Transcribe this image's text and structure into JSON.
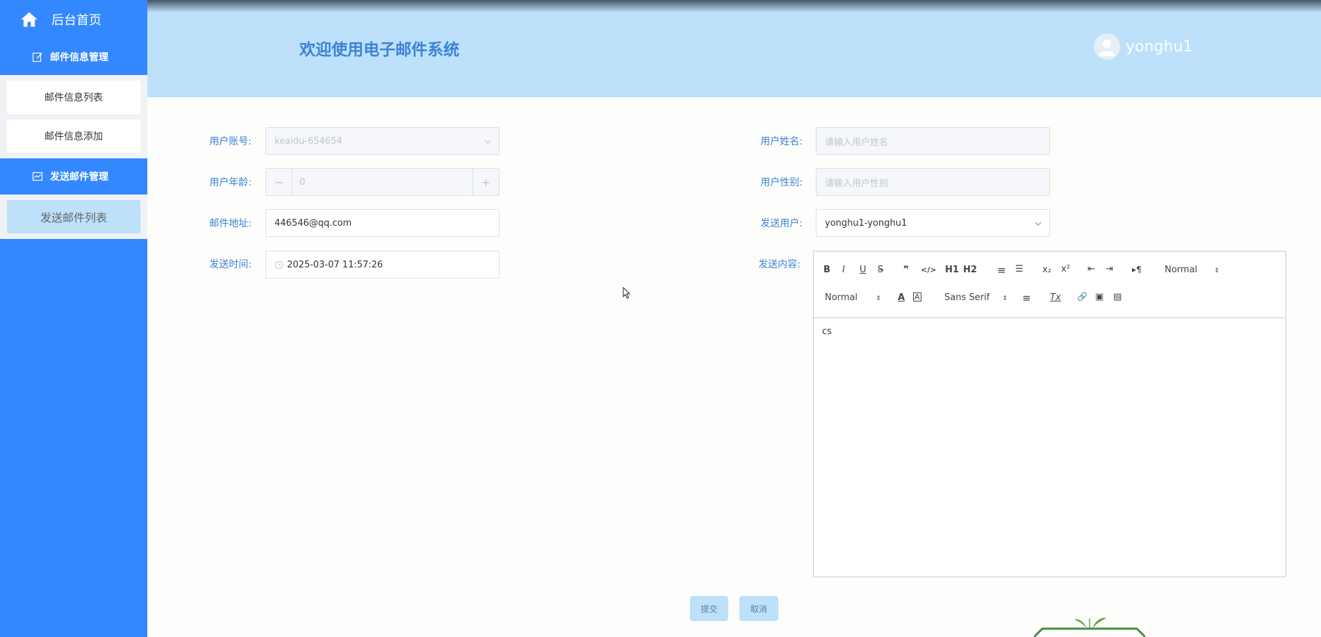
{
  "sidebar": {
    "home_label": "后台首页",
    "groups": [
      {
        "label": "邮件信息管理",
        "items": [
          {
            "label": "邮件信息列表"
          },
          {
            "label": "邮件信息添加"
          }
        ]
      },
      {
        "label": "发送邮件管理",
        "items": [
          {
            "label": "发送邮件列表"
          }
        ]
      }
    ]
  },
  "header": {
    "title": "欢迎使用电子邮件系统",
    "username": "yonghu1"
  },
  "form": {
    "account": {
      "label": "用户账号:",
      "value": "keaidu-654654"
    },
    "name": {
      "label": "用户姓名:",
      "placeholder": "请输入用户姓名"
    },
    "age": {
      "label": "用户年龄:",
      "value": "0",
      "minus": "−",
      "plus": "+"
    },
    "gender": {
      "label": "用户性别:",
      "placeholder": "请输入用户性别"
    },
    "email": {
      "label": "邮件地址:",
      "value": "446546@qq.com"
    },
    "send_user": {
      "label": "发送用户:",
      "value": "yonghu1-yonghu1"
    },
    "send_time": {
      "label": "发送时间:",
      "value": "2025-03-07 11:57:26"
    },
    "content": {
      "label": "发送内容:",
      "value": "cs"
    }
  },
  "editor": {
    "toolbar": {
      "bold": "B",
      "italic": "I",
      "underline": "U",
      "strike": "S",
      "quote": "❞",
      "code": "</>",
      "h1": "H1",
      "h2": "H2",
      "ordered": "≡",
      "bullet": "☰",
      "sub": "x₂",
      "sup": "x²",
      "outdent": "⇤",
      "indent": "⇥",
      "direction": "▸¶",
      "size": "Normal",
      "header": "Normal",
      "font": "Sans Serif",
      "color": "A",
      "background": "A",
      "align": "≡",
      "clean": "Tx",
      "link": "🔗",
      "image": "▣",
      "video": "▤"
    }
  },
  "buttons": {
    "submit": "提交",
    "cancel": "取消"
  }
}
